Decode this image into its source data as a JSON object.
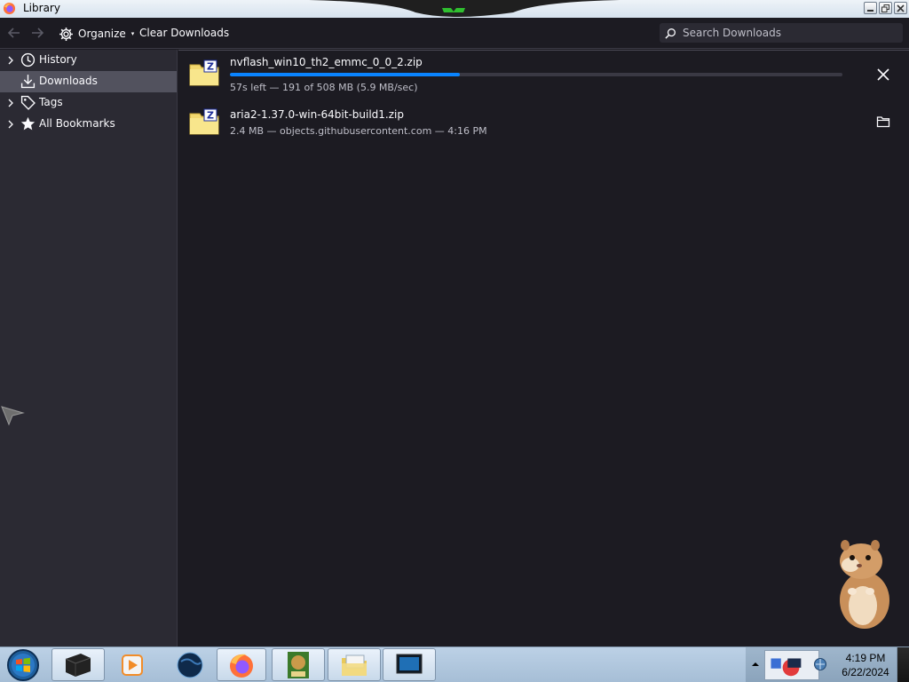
{
  "window": {
    "title": "Library"
  },
  "toolbar": {
    "organize_label": "Organize",
    "clear_label": "Clear Downloads",
    "search": {
      "placeholder": "Search Downloads",
      "value": ""
    }
  },
  "sidebar": {
    "items": [
      {
        "label": "History",
        "icon": "clock-icon",
        "expandable": true,
        "selected": false
      },
      {
        "label": "Downloads",
        "icon": "download-icon",
        "expandable": false,
        "selected": true
      },
      {
        "label": "Tags",
        "icon": "tag-icon",
        "expandable": true,
        "selected": false
      },
      {
        "label": "All Bookmarks",
        "icon": "star-icon",
        "expandable": true,
        "selected": false
      }
    ]
  },
  "downloads": [
    {
      "name": "nvflash_win10_th2_emmc_0_0_2.zip",
      "status": "57s left — 191 of 508 MB (5.9 MB/sec)",
      "progress": 0.376,
      "action": "cancel-icon"
    },
    {
      "name": "aria2-1.37.0-win-64bit-build1.zip",
      "status": "2.4 MB — objects.githubusercontent.com — 4:16 PM",
      "action": "folder-icon"
    }
  ],
  "taskbar": {
    "clock_time": "4:19 PM",
    "clock_date": "6/22/2024",
    "apps": [
      "terminal-icon",
      "media-player-icon",
      "globe-icon",
      "firefox-icon",
      "game-box-icon",
      "explorer-icon",
      "monitor-icon"
    ]
  },
  "colors": {
    "accent": "#0a84ff",
    "sidebar_selected": "#52525e",
    "background": "#1c1b22"
  }
}
